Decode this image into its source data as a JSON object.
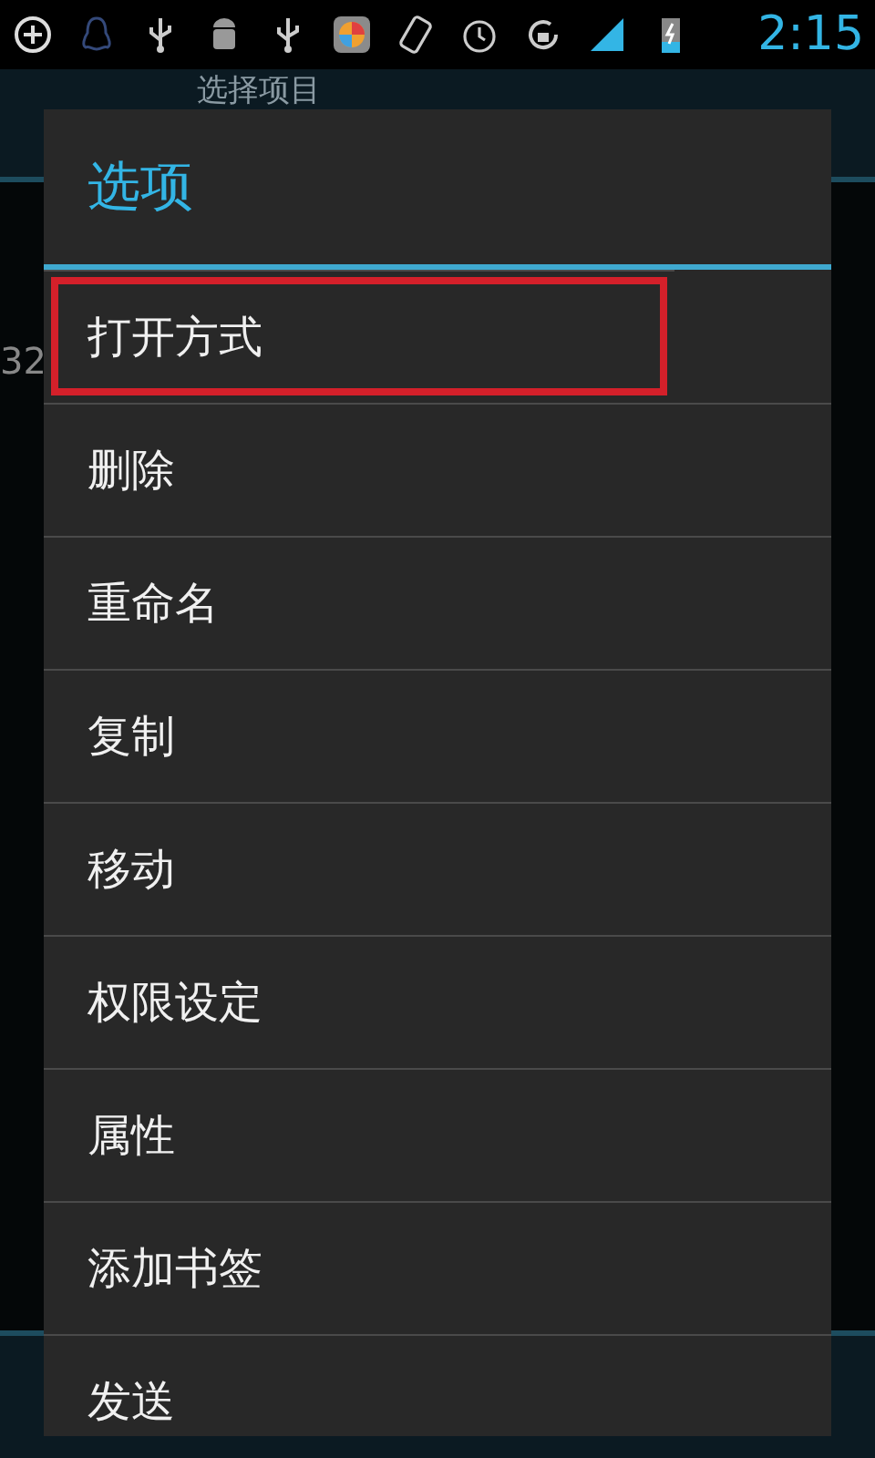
{
  "status_bar": {
    "time": "2:15"
  },
  "background": {
    "title": "选择项目",
    "side_text": "32"
  },
  "dialog": {
    "title": "选项",
    "items": [
      {
        "label": "打开方式",
        "highlighted": true
      },
      {
        "label": "删除",
        "highlighted": false
      },
      {
        "label": "重命名",
        "highlighted": false
      },
      {
        "label": "复制",
        "highlighted": false
      },
      {
        "label": "移动",
        "highlighted": false
      },
      {
        "label": "权限设定",
        "highlighted": false
      },
      {
        "label": "属性",
        "highlighted": false
      },
      {
        "label": "添加书签",
        "highlighted": false
      },
      {
        "label": "发送",
        "highlighted": false
      }
    ]
  }
}
